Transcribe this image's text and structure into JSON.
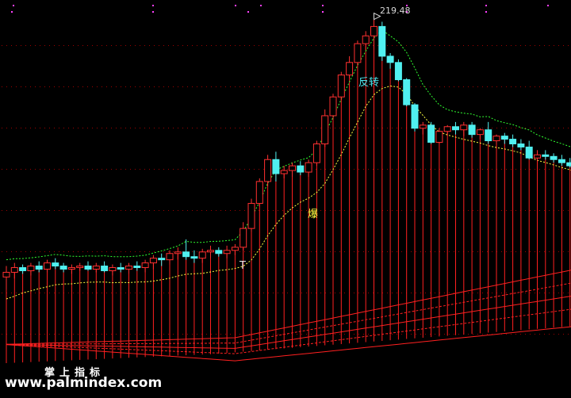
{
  "chart_data": {
    "type": "candlestick",
    "peak_label": "219.48",
    "annotations": [
      {
        "name": "reversal",
        "text": "反转",
        "index": 45
      },
      {
        "name": "burst",
        "text": "爆",
        "index": 39
      },
      {
        "name": "t-mark",
        "text": "T",
        "index": 30
      }
    ],
    "watermark": {
      "cn": "掌上指标",
      "url": "www.palmindex.com"
    },
    "colors": {
      "background": "#000000",
      "up": "#ff3030",
      "down": "#50f0f0",
      "volume_bars": "#ff2020",
      "band_upper": "#30ff30",
      "band_lower": "#ffff40",
      "bottom_lines": "#ff2020",
      "grid_dots": "#a00000",
      "top_dots": "#ff40ff"
    },
    "candles": [
      {
        "o": 55,
        "h": 62,
        "l": 47,
        "c": 58
      },
      {
        "o": 58,
        "h": 64,
        "l": 54,
        "c": 61
      },
      {
        "o": 61,
        "h": 63,
        "l": 57,
        "c": 59
      },
      {
        "o": 59,
        "h": 64,
        "l": 56,
        "c": 62
      },
      {
        "o": 62,
        "h": 65,
        "l": 58,
        "c": 60
      },
      {
        "o": 60,
        "h": 66,
        "l": 58,
        "c": 64
      },
      {
        "o": 64,
        "h": 67,
        "l": 60,
        "c": 62
      },
      {
        "o": 62,
        "h": 64,
        "l": 58,
        "c": 60
      },
      {
        "o": 60,
        "h": 63,
        "l": 57,
        "c": 61
      },
      {
        "o": 61,
        "h": 64,
        "l": 59,
        "c": 62
      },
      {
        "o": 62,
        "h": 65,
        "l": 59,
        "c": 60
      },
      {
        "o": 60,
        "h": 64,
        "l": 58,
        "c": 62
      },
      {
        "o": 62,
        "h": 65,
        "l": 58,
        "c": 59
      },
      {
        "o": 59,
        "h": 63,
        "l": 56,
        "c": 61
      },
      {
        "o": 61,
        "h": 64,
        "l": 58,
        "c": 60
      },
      {
        "o": 60,
        "h": 64,
        "l": 57,
        "c": 62
      },
      {
        "o": 62,
        "h": 65,
        "l": 59,
        "c": 61
      },
      {
        "o": 61,
        "h": 66,
        "l": 58,
        "c": 64
      },
      {
        "o": 64,
        "h": 69,
        "l": 60,
        "c": 67
      },
      {
        "o": 67,
        "h": 70,
        "l": 62,
        "c": 66
      },
      {
        "o": 66,
        "h": 72,
        "l": 63,
        "c": 70
      },
      {
        "o": 70,
        "h": 74,
        "l": 66,
        "c": 71
      },
      {
        "o": 71,
        "h": 79,
        "l": 66,
        "c": 68
      },
      {
        "o": 68,
        "h": 72,
        "l": 64,
        "c": 67
      },
      {
        "o": 67,
        "h": 73,
        "l": 64,
        "c": 71
      },
      {
        "o": 71,
        "h": 75,
        "l": 67,
        "c": 72
      },
      {
        "o": 72,
        "h": 74,
        "l": 68,
        "c": 70
      },
      {
        "o": 70,
        "h": 75,
        "l": 67,
        "c": 72
      },
      {
        "o": 72,
        "h": 76,
        "l": 69,
        "c": 74
      },
      {
        "o": 74,
        "h": 90,
        "l": 72,
        "c": 86
      },
      {
        "o": 86,
        "h": 105,
        "l": 84,
        "c": 102
      },
      {
        "o": 102,
        "h": 118,
        "l": 100,
        "c": 116
      },
      {
        "o": 116,
        "h": 133,
        "l": 113,
        "c": 130
      },
      {
        "o": 130,
        "h": 135,
        "l": 116,
        "c": 121
      },
      {
        "o": 121,
        "h": 126,
        "l": 118,
        "c": 123
      },
      {
        "o": 123,
        "h": 128,
        "l": 119,
        "c": 126
      },
      {
        "o": 126,
        "h": 129,
        "l": 120,
        "c": 122
      },
      {
        "o": 122,
        "h": 130,
        "l": 119,
        "c": 128
      },
      {
        "o": 128,
        "h": 142,
        "l": 126,
        "c": 140
      },
      {
        "o": 140,
        "h": 162,
        "l": 138,
        "c": 158
      },
      {
        "o": 158,
        "h": 172,
        "l": 156,
        "c": 170
      },
      {
        "o": 170,
        "h": 186,
        "l": 168,
        "c": 184
      },
      {
        "o": 184,
        "h": 196,
        "l": 182,
        "c": 192
      },
      {
        "o": 192,
        "h": 206,
        "l": 190,
        "c": 204
      },
      {
        "o": 204,
        "h": 212,
        "l": 200,
        "c": 209
      },
      {
        "o": 209,
        "h": 219.48,
        "l": 200,
        "c": 215
      },
      {
        "o": 215,
        "h": 218,
        "l": 193,
        "c": 196
      },
      {
        "o": 196,
        "h": 198,
        "l": 188,
        "c": 192
      },
      {
        "o": 192,
        "h": 194,
        "l": 180,
        "c": 181
      },
      {
        "o": 181,
        "h": 182,
        "l": 164,
        "c": 165
      },
      {
        "o": 165,
        "h": 166,
        "l": 148,
        "c": 150
      },
      {
        "o": 150,
        "h": 154,
        "l": 146,
        "c": 152
      },
      {
        "o": 152,
        "h": 154,
        "l": 140,
        "c": 141
      },
      {
        "o": 141,
        "h": 150,
        "l": 140,
        "c": 148
      },
      {
        "o": 148,
        "h": 152,
        "l": 146,
        "c": 151
      },
      {
        "o": 151,
        "h": 154,
        "l": 146,
        "c": 149
      },
      {
        "o": 149,
        "h": 154,
        "l": 145,
        "c": 152
      },
      {
        "o": 152,
        "h": 154,
        "l": 144,
        "c": 146
      },
      {
        "o": 146,
        "h": 150,
        "l": 143,
        "c": 149
      },
      {
        "o": 149,
        "h": 154,
        "l": 140,
        "c": 142
      },
      {
        "o": 142,
        "h": 146,
        "l": 140,
        "c": 145
      },
      {
        "o": 145,
        "h": 147,
        "l": 140,
        "c": 143
      },
      {
        "o": 143,
        "h": 146,
        "l": 138,
        "c": 140
      },
      {
        "o": 140,
        "h": 143,
        "l": 136,
        "c": 138
      },
      {
        "o": 138,
        "h": 142,
        "l": 130,
        "c": 131
      },
      {
        "o": 131,
        "h": 136,
        "l": 129,
        "c": 133
      },
      {
        "o": 133,
        "h": 136,
        "l": 130,
        "c": 132
      },
      {
        "o": 132,
        "h": 134,
        "l": 128,
        "c": 130
      },
      {
        "o": 130,
        "h": 133,
        "l": 126,
        "c": 128
      },
      {
        "o": 128,
        "h": 131,
        "l": 125,
        "c": 126
      },
      {
        "o": 126,
        "h": 129,
        "l": 123,
        "c": 125
      },
      {
        "o": 125,
        "h": 128,
        "l": 121,
        "c": 123
      }
    ]
  }
}
